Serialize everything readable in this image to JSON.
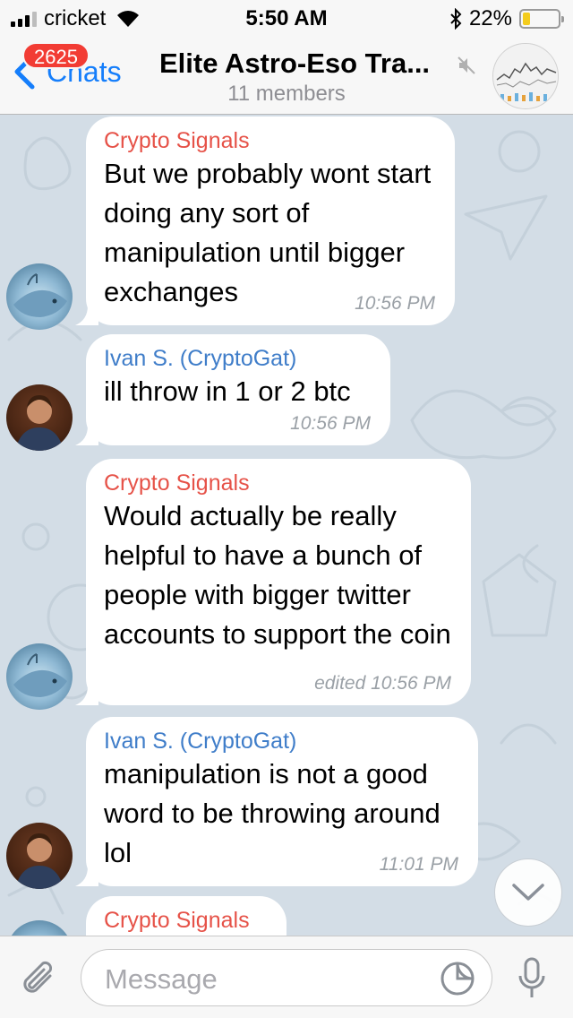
{
  "status_bar": {
    "carrier": "cricket",
    "time": "5:50 AM",
    "battery": "22%"
  },
  "nav": {
    "back_label": "Chats",
    "unread_badge": "2625",
    "title": "Elite Astro-Eso Tra...",
    "subtitle": "11 members"
  },
  "messages": [
    {
      "sender": "Crypto Signals",
      "text": "But we probably wont start doing any sort of manipulation until bigger exchanges",
      "time": "10:56 PM"
    },
    {
      "sender": "Ivan S. (CryptoGat)",
      "text": "ill throw in 1 or 2 btc",
      "time": "10:56 PM"
    },
    {
      "sender": "Crypto Signals",
      "text": "Would actually be really helpful to have a bunch of people with bigger twitter accounts to support the coin",
      "time": "edited 10:56 PM"
    },
    {
      "sender": "Ivan S. (CryptoGat)",
      "text": "manipulation is not a good word to be throwing around lol",
      "time": "11:01 PM"
    },
    {
      "sender": "Crypto Signals",
      "text": "",
      "time": ""
    }
  ],
  "input": {
    "placeholder": "Message"
  },
  "colors": {
    "accent": "#157efb",
    "sender_red": "#e65248",
    "sender_blue": "#3f7dc9",
    "badge": "#f23c34",
    "wallpaper": "#d3dde6"
  },
  "icons": [
    "signal-icon",
    "wifi-icon",
    "bluetooth-icon",
    "battery-icon",
    "back-chevron-icon",
    "mute-icon",
    "attach-icon",
    "sticker-icon",
    "mic-icon",
    "chevron-down-icon"
  ]
}
